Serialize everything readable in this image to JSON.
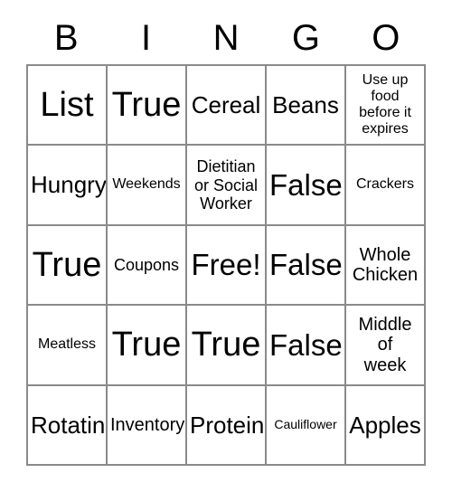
{
  "card": {
    "title": "BINGO",
    "header_letters": [
      "B",
      "I",
      "N",
      "G",
      "O"
    ],
    "border_color": "#8a8a8a",
    "text_color": "#000000",
    "background_color": "#ffffff",
    "columns": 5,
    "rows": 5,
    "free_space": "Free!",
    "cells": [
      {
        "text": "List",
        "size": "fs-xxl"
      },
      {
        "text": "True",
        "size": "fs-xxl"
      },
      {
        "text": "Cereal",
        "size": "fs-lg"
      },
      {
        "text": "Beans",
        "size": "fs-lg"
      },
      {
        "text": "Use up\nfood\nbefore it\nexpires",
        "size": "fs-xs"
      },
      {
        "text": "Hungry",
        "size": "fs-lg"
      },
      {
        "text": "Weekends",
        "size": "fs-xs"
      },
      {
        "text": "Dietitian\nor Social\nWorker",
        "size": "fs-sm"
      },
      {
        "text": "False",
        "size": "fs-xl"
      },
      {
        "text": "Crackers",
        "size": "fs-xs"
      },
      {
        "text": "True",
        "size": "fs-xxl"
      },
      {
        "text": "Coupons",
        "size": "fs-sm"
      },
      {
        "text": "Free!",
        "size": "fs-xl"
      },
      {
        "text": "False",
        "size": "fs-xl"
      },
      {
        "text": "Whole\nChicken",
        "size": "fs-md"
      },
      {
        "text": "Meatless",
        "size": "fs-xs"
      },
      {
        "text": "True",
        "size": "fs-xxl"
      },
      {
        "text": "True",
        "size": "fs-xxl"
      },
      {
        "text": "False",
        "size": "fs-xl"
      },
      {
        "text": "Middle\nof\nweek",
        "size": "fs-md"
      },
      {
        "text": "Rotating",
        "size": "fs-lg"
      },
      {
        "text": "Inventory",
        "size": "fs-md"
      },
      {
        "text": "Protein",
        "size": "fs-lg"
      },
      {
        "text": "Cauliflower",
        "size": "fs-xxs"
      },
      {
        "text": "Apples",
        "size": "fs-lg"
      }
    ]
  }
}
